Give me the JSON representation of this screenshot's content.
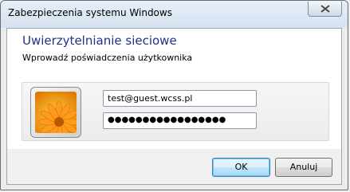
{
  "window": {
    "title": "Zabezpieczenia systemu Windows"
  },
  "header": {
    "heading": "Uwierzytelnianie sieciowe",
    "subheading": "Wprowadź poświadczenia użytkownika"
  },
  "credentials": {
    "username_value": "test@guest.wcss.pl",
    "password_mask": "●●●●●●●●●●●●●●●●●"
  },
  "buttons": {
    "ok_label": "OK",
    "cancel_label": "Anuluj"
  },
  "icons": {
    "close": "close-icon",
    "user_tile": "user-tile-flower"
  },
  "colors": {
    "heading": "#1e3287",
    "accent_button": "#3c7fb1"
  }
}
